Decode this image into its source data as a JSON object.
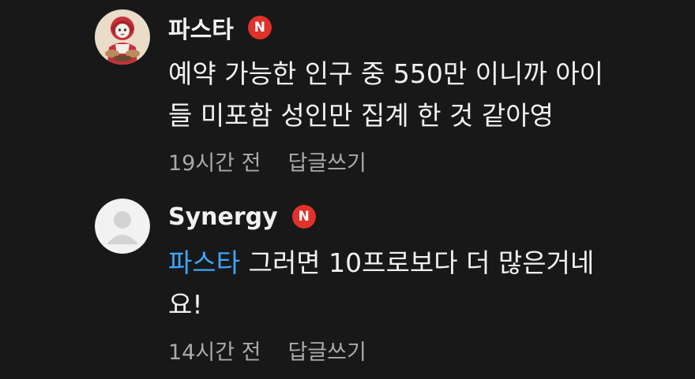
{
  "comments": [
    {
      "author": "파스타",
      "badge": "N",
      "avatar_icon": "illustrated-character-avatar",
      "line1": "예약 가능한 인구 중 550만 이니까 아이",
      "line2": "들 미포함 성인만 집계 한 것 같아영",
      "time": "19시간 전",
      "reply_label": "답글쓰기"
    },
    {
      "author": "Synergy",
      "badge": "N",
      "avatar_icon": "default-user-avatar",
      "mention": "파스타",
      "line1_rest": " 그러면 10프로보다 더 많은거네",
      "line2": "요!",
      "time": "14시간 전",
      "reply_label": "답글쓰기"
    }
  ],
  "colors": {
    "background": "#181818",
    "text": "#f1f1f1",
    "meta": "#aaaaaa",
    "mention": "#3ea6ff",
    "badge": "#e0312a"
  }
}
